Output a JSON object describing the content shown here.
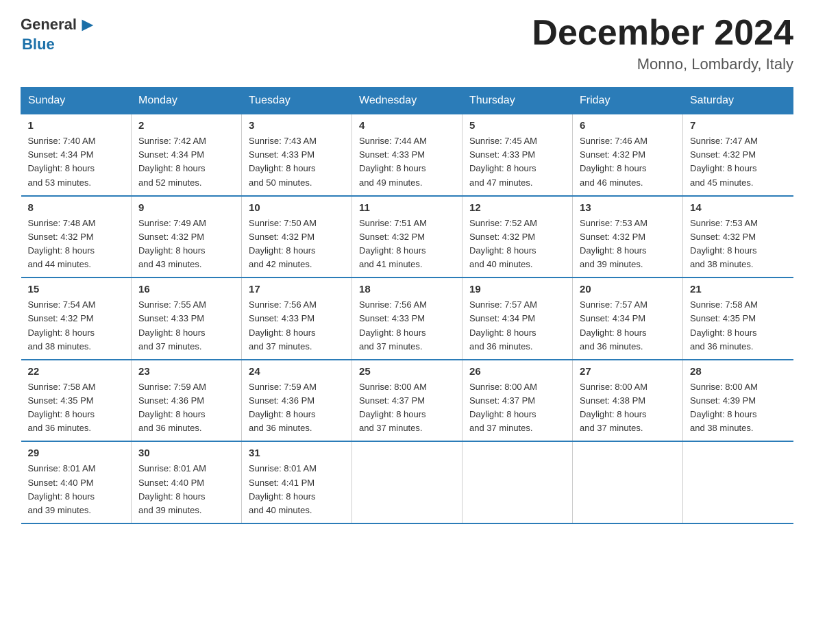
{
  "logo": {
    "general": "General",
    "blue": "Blue"
  },
  "header": {
    "month": "December 2024",
    "location": "Monno, Lombardy, Italy"
  },
  "days_of_week": [
    "Sunday",
    "Monday",
    "Tuesday",
    "Wednesday",
    "Thursday",
    "Friday",
    "Saturday"
  ],
  "weeks": [
    [
      {
        "day": "1",
        "sunrise": "7:40 AM",
        "sunset": "4:34 PM",
        "daylight": "8 hours and 53 minutes."
      },
      {
        "day": "2",
        "sunrise": "7:42 AM",
        "sunset": "4:34 PM",
        "daylight": "8 hours and 52 minutes."
      },
      {
        "day": "3",
        "sunrise": "7:43 AM",
        "sunset": "4:33 PM",
        "daylight": "8 hours and 50 minutes."
      },
      {
        "day": "4",
        "sunrise": "7:44 AM",
        "sunset": "4:33 PM",
        "daylight": "8 hours and 49 minutes."
      },
      {
        "day": "5",
        "sunrise": "7:45 AM",
        "sunset": "4:33 PM",
        "daylight": "8 hours and 47 minutes."
      },
      {
        "day": "6",
        "sunrise": "7:46 AM",
        "sunset": "4:32 PM",
        "daylight": "8 hours and 46 minutes."
      },
      {
        "day": "7",
        "sunrise": "7:47 AM",
        "sunset": "4:32 PM",
        "daylight": "8 hours and 45 minutes."
      }
    ],
    [
      {
        "day": "8",
        "sunrise": "7:48 AM",
        "sunset": "4:32 PM",
        "daylight": "8 hours and 44 minutes."
      },
      {
        "day": "9",
        "sunrise": "7:49 AM",
        "sunset": "4:32 PM",
        "daylight": "8 hours and 43 minutes."
      },
      {
        "day": "10",
        "sunrise": "7:50 AM",
        "sunset": "4:32 PM",
        "daylight": "8 hours and 42 minutes."
      },
      {
        "day": "11",
        "sunrise": "7:51 AM",
        "sunset": "4:32 PM",
        "daylight": "8 hours and 41 minutes."
      },
      {
        "day": "12",
        "sunrise": "7:52 AM",
        "sunset": "4:32 PM",
        "daylight": "8 hours and 40 minutes."
      },
      {
        "day": "13",
        "sunrise": "7:53 AM",
        "sunset": "4:32 PM",
        "daylight": "8 hours and 39 minutes."
      },
      {
        "day": "14",
        "sunrise": "7:53 AM",
        "sunset": "4:32 PM",
        "daylight": "8 hours and 38 minutes."
      }
    ],
    [
      {
        "day": "15",
        "sunrise": "7:54 AM",
        "sunset": "4:32 PM",
        "daylight": "8 hours and 38 minutes."
      },
      {
        "day": "16",
        "sunrise": "7:55 AM",
        "sunset": "4:33 PM",
        "daylight": "8 hours and 37 minutes."
      },
      {
        "day": "17",
        "sunrise": "7:56 AM",
        "sunset": "4:33 PM",
        "daylight": "8 hours and 37 minutes."
      },
      {
        "day": "18",
        "sunrise": "7:56 AM",
        "sunset": "4:33 PM",
        "daylight": "8 hours and 37 minutes."
      },
      {
        "day": "19",
        "sunrise": "7:57 AM",
        "sunset": "4:34 PM",
        "daylight": "8 hours and 36 minutes."
      },
      {
        "day": "20",
        "sunrise": "7:57 AM",
        "sunset": "4:34 PM",
        "daylight": "8 hours and 36 minutes."
      },
      {
        "day": "21",
        "sunrise": "7:58 AM",
        "sunset": "4:35 PM",
        "daylight": "8 hours and 36 minutes."
      }
    ],
    [
      {
        "day": "22",
        "sunrise": "7:58 AM",
        "sunset": "4:35 PM",
        "daylight": "8 hours and 36 minutes."
      },
      {
        "day": "23",
        "sunrise": "7:59 AM",
        "sunset": "4:36 PM",
        "daylight": "8 hours and 36 minutes."
      },
      {
        "day": "24",
        "sunrise": "7:59 AM",
        "sunset": "4:36 PM",
        "daylight": "8 hours and 36 minutes."
      },
      {
        "day": "25",
        "sunrise": "8:00 AM",
        "sunset": "4:37 PM",
        "daylight": "8 hours and 37 minutes."
      },
      {
        "day": "26",
        "sunrise": "8:00 AM",
        "sunset": "4:37 PM",
        "daylight": "8 hours and 37 minutes."
      },
      {
        "day": "27",
        "sunrise": "8:00 AM",
        "sunset": "4:38 PM",
        "daylight": "8 hours and 37 minutes."
      },
      {
        "day": "28",
        "sunrise": "8:00 AM",
        "sunset": "4:39 PM",
        "daylight": "8 hours and 38 minutes."
      }
    ],
    [
      {
        "day": "29",
        "sunrise": "8:01 AM",
        "sunset": "4:40 PM",
        "daylight": "8 hours and 39 minutes."
      },
      {
        "day": "30",
        "sunrise": "8:01 AM",
        "sunset": "4:40 PM",
        "daylight": "8 hours and 39 minutes."
      },
      {
        "day": "31",
        "sunrise": "8:01 AM",
        "sunset": "4:41 PM",
        "daylight": "8 hours and 40 minutes."
      },
      null,
      null,
      null,
      null
    ]
  ],
  "labels": {
    "sunrise": "Sunrise:",
    "sunset": "Sunset:",
    "daylight": "Daylight:"
  }
}
